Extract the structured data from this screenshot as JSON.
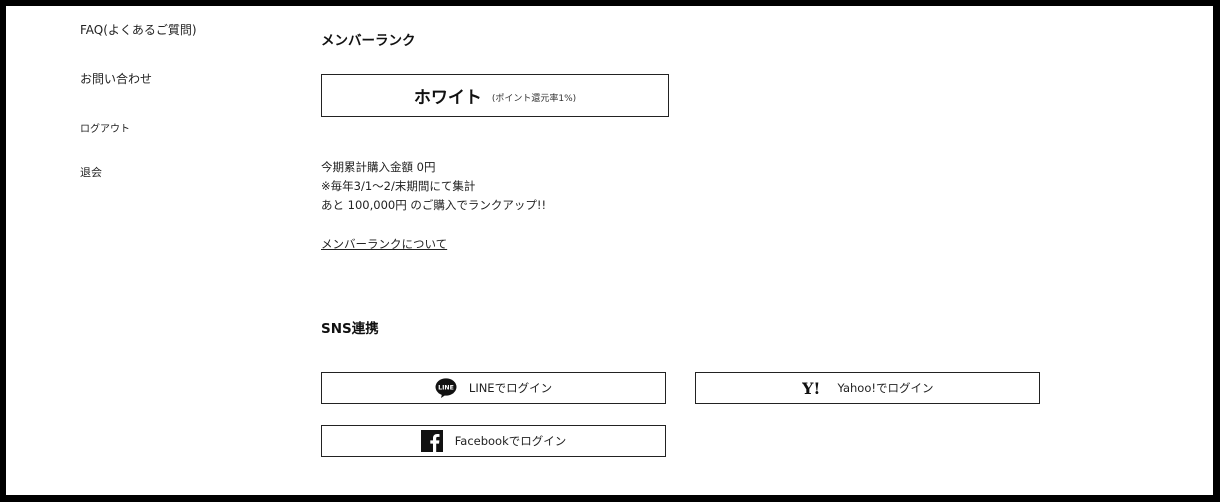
{
  "sidebar": {
    "items": [
      {
        "label": "FAQ(よくあるご質問)"
      },
      {
        "label": "お問い合わせ"
      },
      {
        "label": "ログアウト"
      },
      {
        "label": "退会"
      }
    ]
  },
  "member_rank": {
    "title": "メンバーランク",
    "rank_name": "ホワイト",
    "rank_note": "(ポイント還元率1%)",
    "lines": [
      "今期累計購入金額 0円",
      "※毎年3/1～2/末期間にて集計",
      "あと 100,000円 のご購入でランクアップ!!"
    ],
    "link_label": "メンバーランクについて"
  },
  "sns": {
    "title": "SNS連携",
    "line_label": "LINEでログイン",
    "yahoo_label": "Yahoo!でログイン",
    "facebook_label": "Facebookでログイン",
    "line_icon_text": "LINE",
    "yahoo_icon_text": "Y!"
  },
  "colors": {
    "border": "#222222",
    "background": "#ffffff",
    "frame": "#000000"
  },
  "icons": {
    "line": "line-icon",
    "yahoo": "yahoo-icon",
    "facebook": "facebook-icon"
  }
}
